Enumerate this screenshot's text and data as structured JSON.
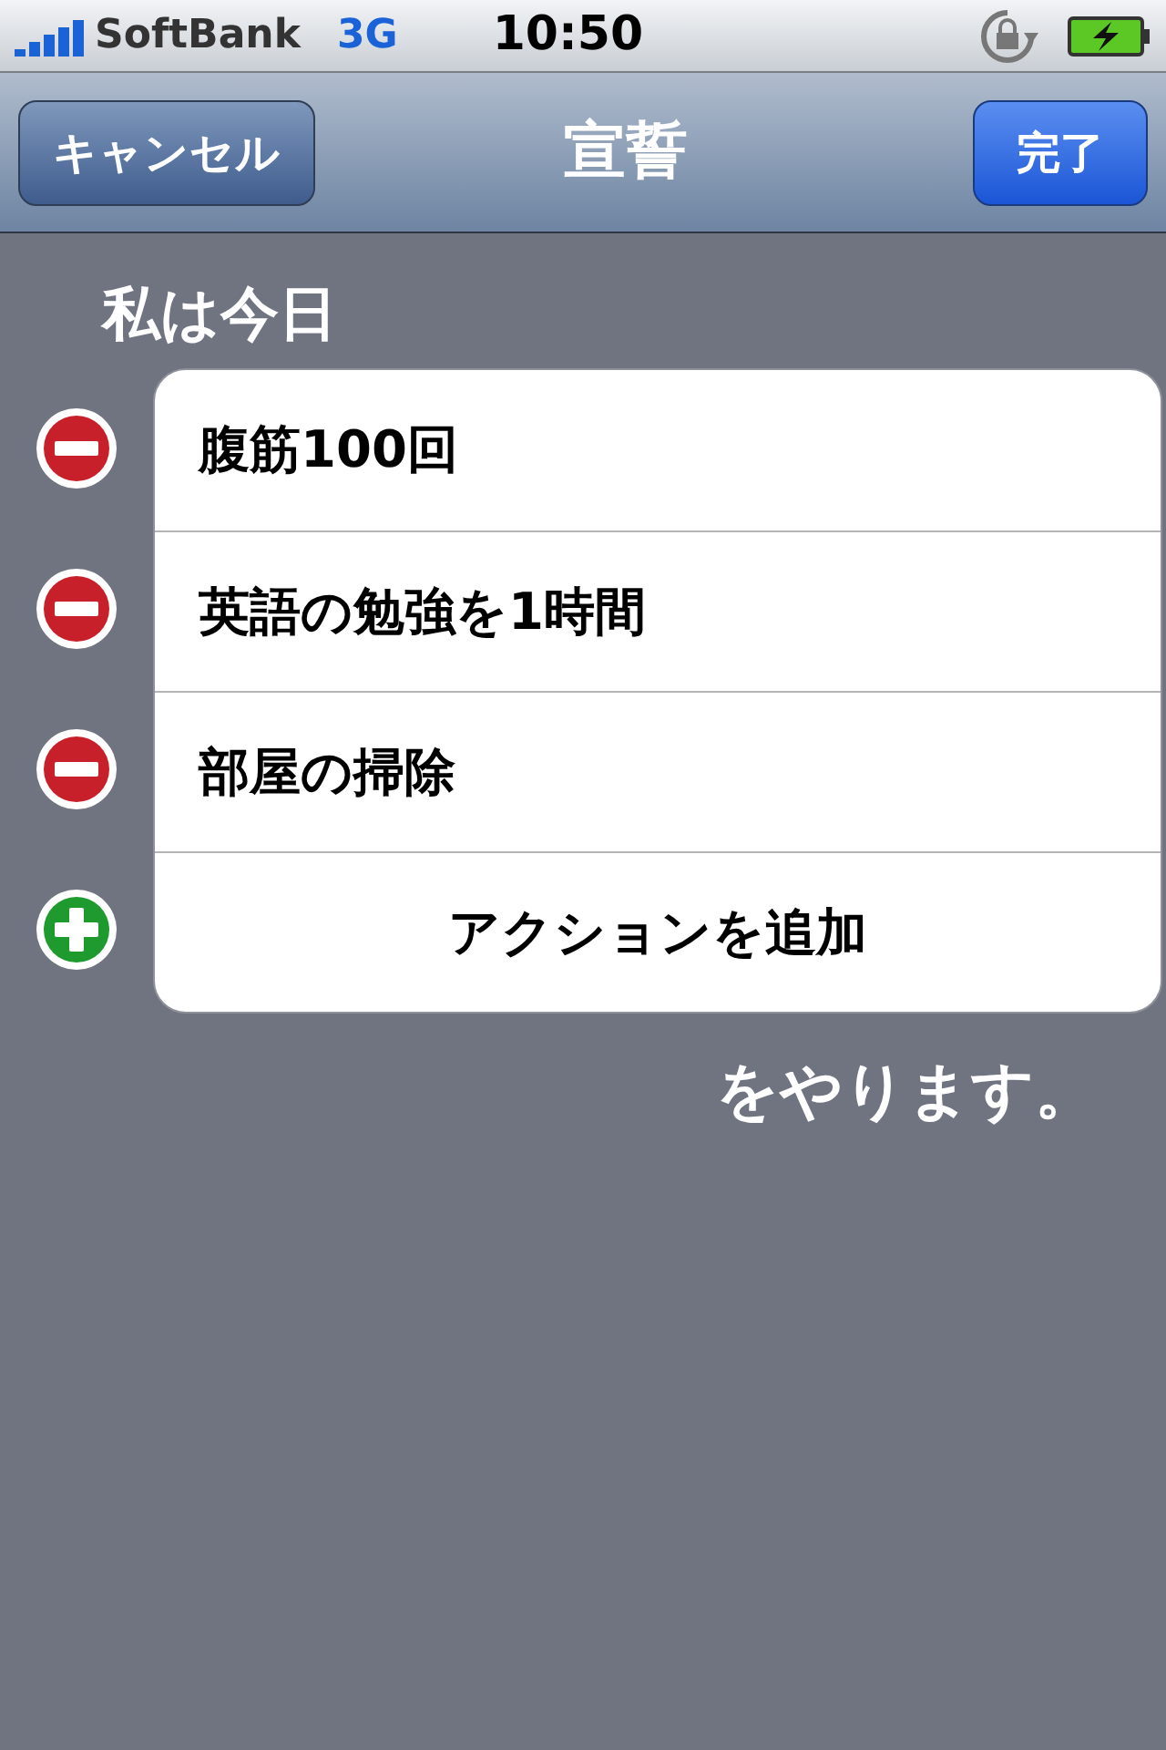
{
  "status_bar": {
    "carrier": "SoftBank",
    "network": "3G",
    "time": "10:50"
  },
  "nav_bar": {
    "left_button": "キャンセル",
    "title": "宣誓",
    "right_button": "完了"
  },
  "header": "私は今日",
  "rows": [
    {
      "kind": "delete",
      "label": "腹筋100回"
    },
    {
      "kind": "delete",
      "label": "英語の勉強を1時間"
    },
    {
      "kind": "delete",
      "label": "部屋の掃除"
    },
    {
      "kind": "add",
      "label": "アクションを追加"
    }
  ],
  "footer": "をやります。"
}
